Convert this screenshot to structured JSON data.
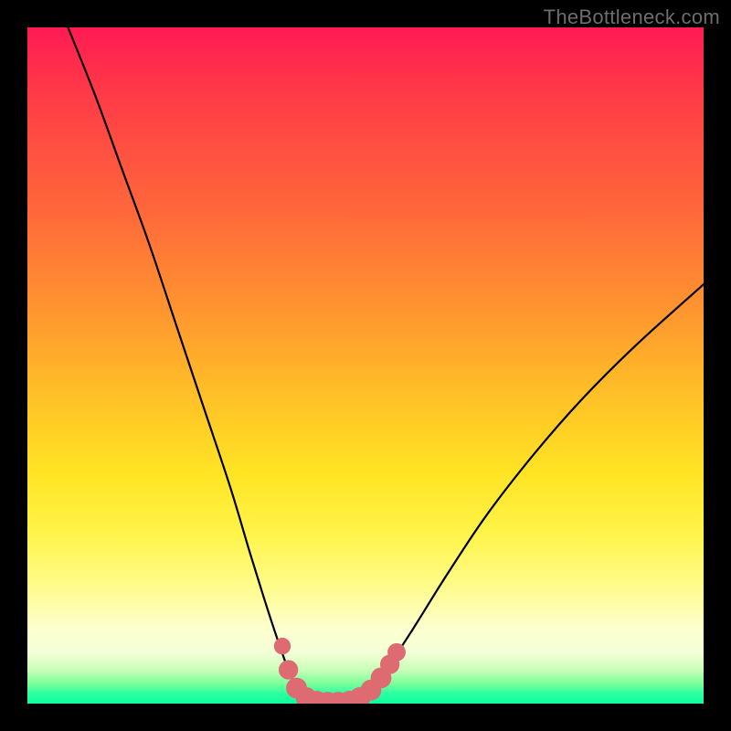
{
  "watermark": "TheBottleneck.com",
  "chart_data": {
    "type": "line",
    "title": "",
    "xlabel": "",
    "ylabel": "",
    "xlim": [
      0,
      100
    ],
    "ylim": [
      0,
      100
    ],
    "background_gradient_stops": [
      {
        "pos": 0,
        "color": "#ff1a53"
      },
      {
        "pos": 10,
        "color": "#ff3b47"
      },
      {
        "pos": 28,
        "color": "#ff6a3a"
      },
      {
        "pos": 42,
        "color": "#ff962f"
      },
      {
        "pos": 55,
        "color": "#ffc227"
      },
      {
        "pos": 66,
        "color": "#ffe424"
      },
      {
        "pos": 75,
        "color": "#fff44a"
      },
      {
        "pos": 83,
        "color": "#fffc8f"
      },
      {
        "pos": 89,
        "color": "#fdffd0"
      },
      {
        "pos": 92.5,
        "color": "#f3ffd6"
      },
      {
        "pos": 95,
        "color": "#c9ffb8"
      },
      {
        "pos": 97,
        "color": "#7dff9a"
      },
      {
        "pos": 98.5,
        "color": "#2dffa0"
      },
      {
        "pos": 100,
        "color": "#0bff9e"
      }
    ],
    "series": [
      {
        "name": "bottleneck-curve",
        "color": "#000000",
        "x": [
          6,
          10,
          14,
          18,
          22,
          26,
          30,
          33,
          35.5,
          37.5,
          39,
          40.5,
          42,
          44,
          46,
          48,
          50,
          53,
          57,
          62,
          68,
          75,
          82,
          90,
          100
        ],
        "y": [
          100,
          90,
          79,
          68,
          56,
          44,
          32,
          22,
          14,
          8,
          4,
          1.5,
          0.5,
          0.2,
          0.2,
          0.5,
          1.5,
          5,
          11,
          19,
          28,
          37,
          45,
          53,
          62
        ]
      }
    ],
    "highlight": {
      "name": "optimal-zone-dots",
      "color": "#de6a72",
      "points": [
        {
          "x": 37.7,
          "y": 8.5,
          "r": 0.7
        },
        {
          "x": 38.6,
          "y": 5.0,
          "r": 0.9
        },
        {
          "x": 39.8,
          "y": 2.3,
          "r": 1.0
        },
        {
          "x": 41.2,
          "y": 0.9,
          "r": 1.0
        },
        {
          "x": 42.8,
          "y": 0.35,
          "r": 1.0
        },
        {
          "x": 44.4,
          "y": 0.2,
          "r": 1.0
        },
        {
          "x": 46.0,
          "y": 0.2,
          "r": 1.0
        },
        {
          "x": 47.6,
          "y": 0.35,
          "r": 1.0
        },
        {
          "x": 49.2,
          "y": 0.9,
          "r": 1.0
        },
        {
          "x": 50.8,
          "y": 2.0,
          "r": 1.0
        },
        {
          "x": 52.3,
          "y": 3.8,
          "r": 1.0
        },
        {
          "x": 53.6,
          "y": 5.8,
          "r": 0.9
        },
        {
          "x": 54.6,
          "y": 7.6,
          "r": 0.8
        }
      ]
    }
  }
}
